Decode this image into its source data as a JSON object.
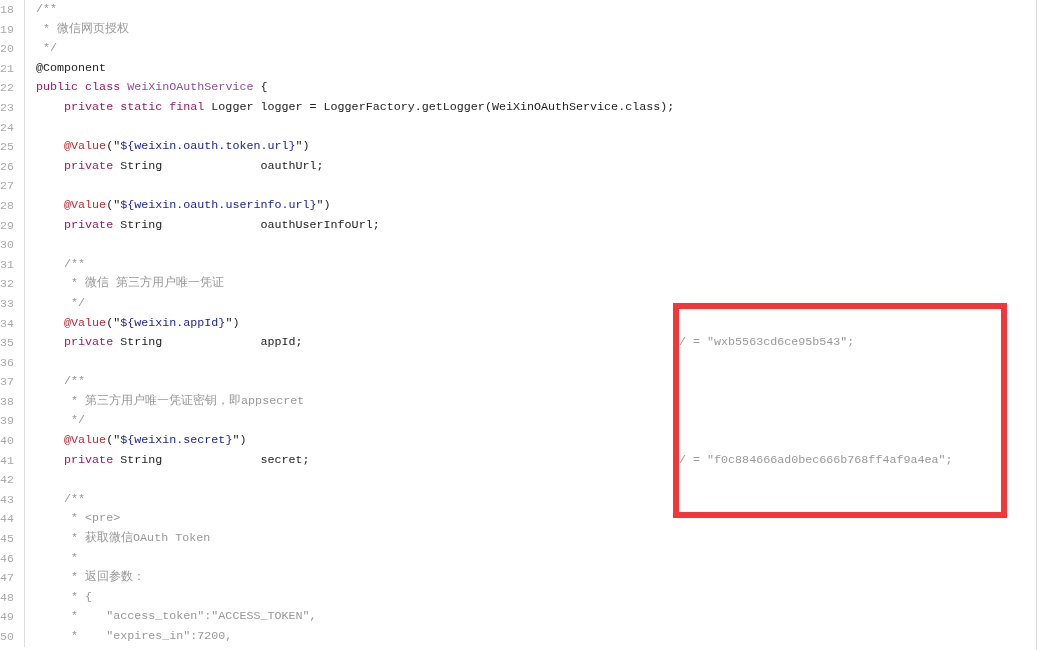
{
  "code_lines": [
    {
      "number": "18",
      "segments": [
        {
          "kind": "comment",
          "text": "/**"
        }
      ]
    },
    {
      "number": "19",
      "segments": [
        {
          "kind": "comment",
          "text": " * 微信网页授权"
        }
      ]
    },
    {
      "number": "20",
      "segments": [
        {
          "kind": "comment",
          "text": " */"
        }
      ]
    },
    {
      "number": "21",
      "segments": [
        {
          "kind": "plain",
          "text": "@Component"
        }
      ]
    },
    {
      "number": "22",
      "segments": [
        {
          "kind": "keyword",
          "text": "public class "
        },
        {
          "kind": "classname",
          "text": "WeiXinOAuthService"
        },
        {
          "kind": "plain",
          "text": " {"
        }
      ]
    },
    {
      "number": "23",
      "segments": [
        {
          "kind": "keyword",
          "text": "    private static final "
        },
        {
          "kind": "plain",
          "text": "Logger logger = LoggerFactory.getLogger(WeiXinOAuthService.class);"
        }
      ]
    },
    {
      "number": "24"
    },
    {
      "number": "25",
      "segments": [
        {
          "kind": "annotation",
          "text": "    @Value"
        },
        {
          "kind": "plain",
          "text": "(\""
        },
        {
          "kind": "string",
          "text": "${weixin.oauth.token.url}"
        },
        {
          "kind": "plain",
          "text": "\")"
        }
      ]
    },
    {
      "number": "26",
      "segments": [
        {
          "kind": "keyword",
          "text": "    private "
        },
        {
          "kind": "plain",
          "text": "String              oauthUrl;"
        }
      ]
    },
    {
      "number": "27"
    },
    {
      "number": "28",
      "segments": [
        {
          "kind": "annotation",
          "text": "    @Value"
        },
        {
          "kind": "plain",
          "text": "(\""
        },
        {
          "kind": "string",
          "text": "${weixin.oauth.userinfo.url}"
        },
        {
          "kind": "plain",
          "text": "\")"
        }
      ]
    },
    {
      "number": "29",
      "segments": [
        {
          "kind": "keyword",
          "text": "    private "
        },
        {
          "kind": "plain",
          "text": "String              oauthUserInfoUrl;"
        }
      ]
    },
    {
      "number": "30"
    },
    {
      "number": "31",
      "segments": [
        {
          "kind": "comment",
          "text": "    /**"
        }
      ]
    },
    {
      "number": "32",
      "segments": [
        {
          "kind": "comment",
          "text": "     * 微信 第三方用户唯一凭证"
        }
      ]
    },
    {
      "number": "33",
      "segments": [
        {
          "kind": "comment",
          "text": "     */"
        }
      ]
    },
    {
      "number": "34",
      "segments": [
        {
          "kind": "annotation",
          "text": "    @Value"
        },
        {
          "kind": "plain",
          "text": "(\""
        },
        {
          "kind": "string",
          "text": "${weixin.appId}"
        },
        {
          "kind": "plain",
          "text": "\")"
        }
      ]
    },
    {
      "number": "35",
      "segments": [
        {
          "kind": "keyword",
          "text": "    private "
        },
        {
          "kind": "plain",
          "text": "String              appId;"
        }
      ],
      "tail": "/ = \"wxb5563cd6ce95b543\";"
    },
    {
      "number": "36"
    },
    {
      "number": "37",
      "segments": [
        {
          "kind": "comment",
          "text": "    /**"
        }
      ]
    },
    {
      "number": "38",
      "segments": [
        {
          "kind": "comment",
          "text": "     * 第三方用户唯一凭证密钥，即appsecret"
        }
      ]
    },
    {
      "number": "39",
      "segments": [
        {
          "kind": "comment",
          "text": "     */"
        }
      ]
    },
    {
      "number": "40",
      "segments": [
        {
          "kind": "annotation",
          "text": "    @Value"
        },
        {
          "kind": "plain",
          "text": "(\""
        },
        {
          "kind": "string",
          "text": "${weixin.secret}"
        },
        {
          "kind": "plain",
          "text": "\")"
        }
      ]
    },
    {
      "number": "41",
      "segments": [
        {
          "kind": "keyword",
          "text": "    private "
        },
        {
          "kind": "plain",
          "text": "String              secret;"
        }
      ],
      "tail": "/ = \"f0c884666ad0bec666b768ff4af9a4ea\";"
    },
    {
      "number": "42"
    },
    {
      "number": "43",
      "segments": [
        {
          "kind": "comment",
          "text": "    /**"
        }
      ]
    },
    {
      "number": "44",
      "segments": [
        {
          "kind": "comment",
          "text": "     * <pre>"
        }
      ]
    },
    {
      "number": "45",
      "segments": [
        {
          "kind": "comment",
          "text": "     * 获取微信OAuth Token"
        }
      ]
    },
    {
      "number": "46",
      "segments": [
        {
          "kind": "comment",
          "text": "     *"
        }
      ]
    },
    {
      "number": "47",
      "segments": [
        {
          "kind": "comment",
          "text": "     * 返回参数："
        }
      ]
    },
    {
      "number": "48",
      "segments": [
        {
          "kind": "comment",
          "text": "     * {"
        }
      ]
    },
    {
      "number": "49",
      "segments": [
        {
          "kind": "comment",
          "text": "     *    \"access_token\":\"ACCESS_TOKEN\","
        }
      ]
    },
    {
      "number": "50",
      "segments": [
        {
          "kind": "comment",
          "text": "     *    \"expires_in\":7200,"
        }
      ]
    }
  ]
}
